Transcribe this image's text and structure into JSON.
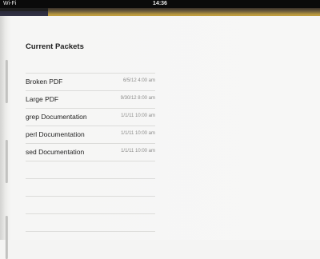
{
  "status_bar": {
    "carrier": "Wi-Fi",
    "time": "14:36"
  },
  "main": {
    "title": "Current Packets",
    "packets": [
      {
        "name": "Broken PDF",
        "date": "6/5/12 4:00 am"
      },
      {
        "name": "Large PDF",
        "date": "9/30/12 8:00 am"
      },
      {
        "name": "grep Documentation",
        "date": "1/1/11 10:00 am"
      },
      {
        "name": "perl Documentation",
        "date": "1/1/11 10:00 am"
      },
      {
        "name": "sed Documentation",
        "date": "1/1/11 10:00 am"
      }
    ]
  },
  "colors": {
    "accent_band": "#c9a33c",
    "status_bar": "#0a0a0a",
    "page": "#f7f7f6"
  }
}
